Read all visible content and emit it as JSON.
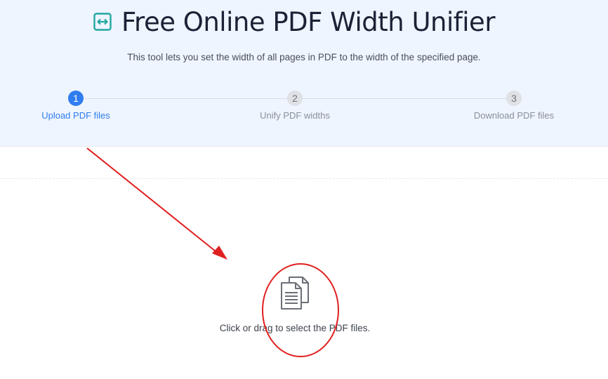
{
  "header": {
    "title": "Free Online PDF Width Unifier",
    "subtitle": "This tool lets you set the width of all pages in PDF to the width of the specified page.",
    "icon": "arrows-horizontal-icon",
    "accent_color": "#22a6a0"
  },
  "steps": [
    {
      "number": "1",
      "label": "Upload PDF files",
      "active": true
    },
    {
      "number": "2",
      "label": "Unify PDF widths",
      "active": false
    },
    {
      "number": "3",
      "label": "Download PDF files",
      "active": false
    }
  ],
  "upload": {
    "icon": "documents-icon",
    "text": "Click or drag to select the PDF files."
  },
  "colors": {
    "hero_background": "#eef5fe",
    "active_step": "#2f7df0",
    "annotation": "#e02020"
  }
}
